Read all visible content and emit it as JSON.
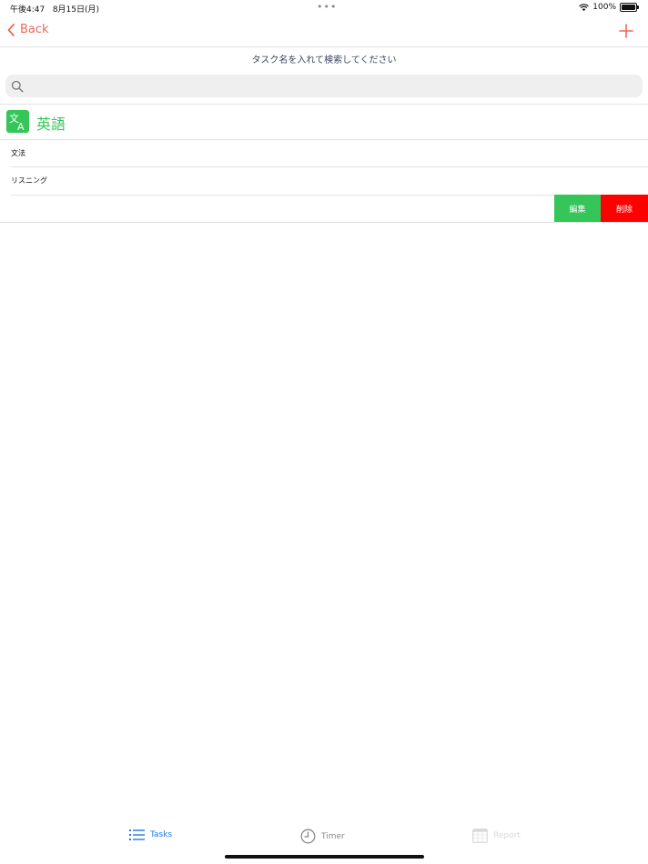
{
  "status_bar": {
    "time": "午後4:47",
    "date": "8月15日(月)",
    "dots": "•••",
    "battery_percent": "100%"
  },
  "navbar": {
    "back_label": "Back",
    "back_icon": "chevron-left-icon",
    "add_icon": "plus-icon"
  },
  "search": {
    "label": "タスク名を入れて検索してください",
    "placeholder": ""
  },
  "category": {
    "icon": "translate-icon",
    "title": "英語"
  },
  "tasks": [
    {
      "label": "文法"
    },
    {
      "label": "リスニング"
    },
    {
      "label": ""
    }
  ],
  "swipe_actions": {
    "edit_label": "編集",
    "delete_label": "削除"
  },
  "tabbar": {
    "tasks_label": "Tasks",
    "timer_label": "Timer",
    "report_label": "Report"
  },
  "colors": {
    "accent_red": "#f0655a",
    "green": "#35c659",
    "delete_red": "#ff0000",
    "tab_active": "#1a7ae0"
  }
}
